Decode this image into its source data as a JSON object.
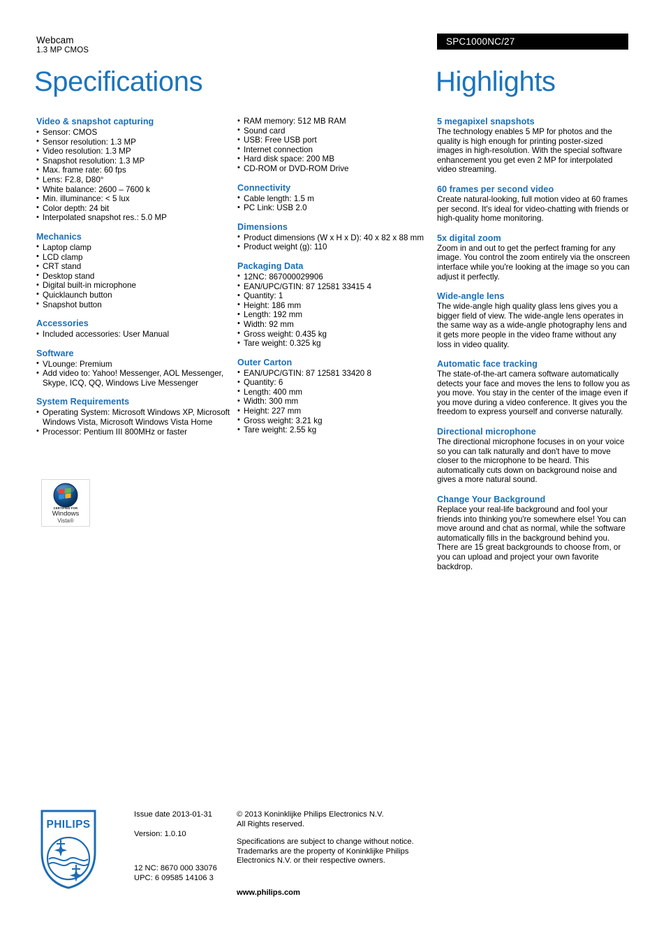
{
  "header": {
    "product_category": "Webcam",
    "product_subtitle": "1.3 MP CMOS",
    "product_code": "SPC1000NC/27",
    "left_title": "Specifications",
    "right_title": "Highlights"
  },
  "specifications": {
    "column_1": [
      {
        "heading": "Video & snapshot capturing",
        "items": [
          "Sensor: CMOS",
          "Sensor resolution: 1.3 MP",
          "Video resolution: 1.3 MP",
          "Snapshot resolution: 1.3 MP",
          "Max. frame rate: 60 fps",
          "Lens: F2.8, D80°",
          "White balance: 2600 – 7600 k",
          "Min. illuminance: < 5 lux",
          "Color depth: 24 bit",
          "Interpolated snapshot res.: 5.0 MP"
        ]
      },
      {
        "heading": "Mechanics",
        "items": [
          "Laptop clamp",
          "LCD clamp",
          "CRT stand",
          "Desktop stand",
          "Digital built-in microphone",
          "Quicklaunch button",
          "Snapshot button"
        ]
      },
      {
        "heading": "Accessories",
        "items": [
          "Included accessories: User Manual"
        ]
      },
      {
        "heading": "Software",
        "items": [
          "VLounge: Premium",
          "Add video to: Yahoo! Messenger, AOL Messenger, Skype, ICQ, QQ, Windows Live Messenger"
        ]
      },
      {
        "heading": "System Requirements",
        "items": [
          "Operating System: Microsoft Windows XP, Microsoft Windows Vista, Microsoft Windows Vista Home",
          "Processor: Pentium III 800MHz or faster"
        ]
      }
    ],
    "column_2": [
      {
        "heading": "",
        "items": [
          "RAM memory: 512 MB RAM",
          "Sound card",
          "USB: Free USB port",
          "Internet connection",
          "Hard disk space: 200 MB",
          "CD-ROM or DVD-ROM Drive"
        ]
      },
      {
        "heading": "Connectivity",
        "items": [
          "Cable length: 1.5 m",
          "PC Link: USB 2.0"
        ]
      },
      {
        "heading": "Dimensions",
        "items": [
          "Product dimensions (W x H x D): 40 x 82 x 88 mm",
          "Product weight (g): 110"
        ]
      },
      {
        "heading": "Packaging Data",
        "items": [
          "12NC: 867000029906",
          "EAN/UPC/GTIN: 87 12581 33415 4",
          "Quantity: 1",
          "Height: 186 mm",
          "Length: 192 mm",
          "Width: 92 mm",
          "Gross weight: 0.435 kg",
          "Tare weight: 0.325 kg"
        ]
      },
      {
        "heading": "Outer Carton",
        "items": [
          "EAN/UPC/GTIN: 87 12581 33420 8",
          "Quantity: 6",
          "Length: 400 mm",
          "Width: 300 mm",
          "Height: 227 mm",
          "Gross weight: 3.21 kg",
          "Tare weight: 2.55 kg"
        ]
      }
    ]
  },
  "highlights": [
    {
      "heading": "5 megapixel snapshots",
      "body": "The technology enables 5 MP for photos and the quality is high enough for printing poster-sized images in high-resolution. With the special software enhancement you get even 2 MP for interpolated video streaming."
    },
    {
      "heading": "60 frames per second video",
      "body": "Create natural-looking, full motion video at 60 frames per second. It's ideal for video-chatting with friends or high-quality home monitoring."
    },
    {
      "heading": "5x digital zoom",
      "body": "Zoom in and out to get the perfect framing for any image. You control the zoom entirely via the onscreen interface while you're looking at the image so you can adjust it perfectly."
    },
    {
      "heading": "Wide-angle lens",
      "body": "The wide-angle high quality glass lens gives you a bigger field of view. The wide-angle lens operates in the same way as a wide-angle photography lens and it gets more people in the video frame without any loss in video quality."
    },
    {
      "heading": "Automatic face tracking",
      "body": "The state-of-the-art camera software automatically detects your face and moves the lens to follow you as you move. You stay in the center of the image even if you move during a video conference. It gives you the freedom to express yourself and converse naturally."
    },
    {
      "heading": "Directional microphone",
      "body": "The directional microphone focuses in on your voice so you can talk naturally and don't have to move closer to the microphone to be heard. This automatically cuts down on background noise and gives a more natural sound."
    },
    {
      "heading": "Change Your Background",
      "body": "Replace your real-life background and fool your friends into thinking you're somewhere else! You can move around and chat as normal, while the software automatically fills in the background behind you. There are 15 great backgrounds to choose from, or you can upload and project your own favorite backdrop."
    }
  ],
  "badge": {
    "certified_for": "CERTIFIED FOR",
    "windows": "Windows",
    "vista": "Vista®"
  },
  "footer": {
    "logo_wordmark": "PHILIPS",
    "issue_date": "Issue date 2013-01-31",
    "version": "Version: 1.0.10",
    "nc_code": "12 NC: 8670 000 33076",
    "upc_code": "UPC: 6 09585 14106 3",
    "copyright_line_1": "© 2013 Koninklijke Philips Electronics N.V.",
    "copyright_line_2": "All Rights reserved.",
    "disclaimer": "Specifications are subject to change without notice. Trademarks are the property of Koninklijke Philips Electronics N.V. or their respective owners.",
    "website": "www.philips.com"
  },
  "colors": {
    "heading_blue": "#1b6fb8",
    "title_blue": "#1b74bd",
    "code_bar": "#000000",
    "philips_blue": "#1e6cb5"
  }
}
